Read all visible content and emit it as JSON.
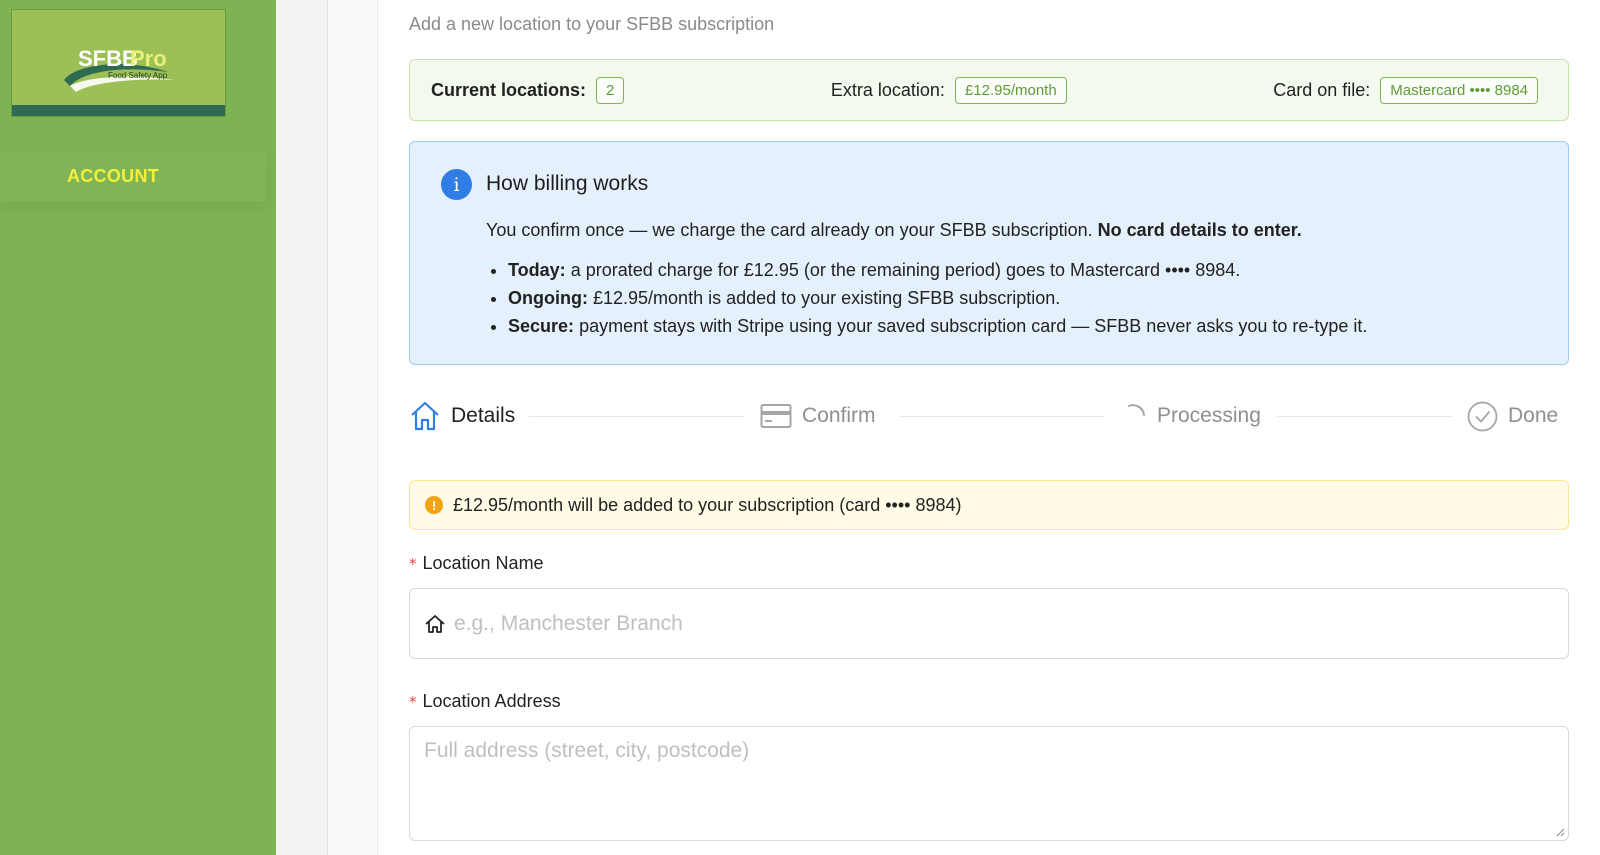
{
  "sidebar": {
    "logo": {
      "brand_primary": "SFBB",
      "brand_secondary": "Pro",
      "tagline": "Food Safety App"
    },
    "items": [
      {
        "label": "ACCOUNT"
      }
    ]
  },
  "header": {
    "subtitle": "Add a new location to your SFBB subscription"
  },
  "summary": {
    "current_locations_label": "Current locations:",
    "current_locations_value": "2",
    "extra_location_label": "Extra location:",
    "extra_location_value": "£12.95/month",
    "card_label": "Card on file:",
    "card_value": "Mastercard •••• 8984"
  },
  "billing": {
    "title": "How billing works",
    "desc_text": "You confirm once — we charge the card already on your SFBB subscription.",
    "desc_bold": "No card details to enter.",
    "items": [
      {
        "bold": "Today:",
        "text": "a prorated charge for £12.95 (or the remaining period) goes to Mastercard •••• 8984."
      },
      {
        "bold": "Ongoing:",
        "text": "£12.95/month is added to your existing SFBB subscription."
      },
      {
        "bold": "Secure:",
        "text": "payment stays with Stripe using your saved subscription card — SFBB never asks you to re-type it."
      }
    ]
  },
  "steps": [
    {
      "label": "Details",
      "icon": "home-icon",
      "state": "active"
    },
    {
      "label": "Confirm",
      "icon": "credit-card-icon",
      "state": "pending"
    },
    {
      "label": "Processing",
      "icon": "loading-icon",
      "state": "pending"
    },
    {
      "label": "Done",
      "icon": "check-circle-icon",
      "state": "pending"
    }
  ],
  "notice": {
    "text": "£12.95/month will be added to your subscription (card •••• 8984)"
  },
  "form": {
    "location_name": {
      "label": "Location Name",
      "placeholder": "e.g., Manchester Branch",
      "value": ""
    },
    "location_address": {
      "label": "Location Address",
      "placeholder": "Full address (street, city, postcode)",
      "value": ""
    }
  },
  "colors": {
    "sidebar_bg": "#7db353",
    "accent_green": "#7fb556",
    "info_blue": "#2f7ee6",
    "warning": "#f4a20f",
    "account_text": "#f4f03a"
  }
}
